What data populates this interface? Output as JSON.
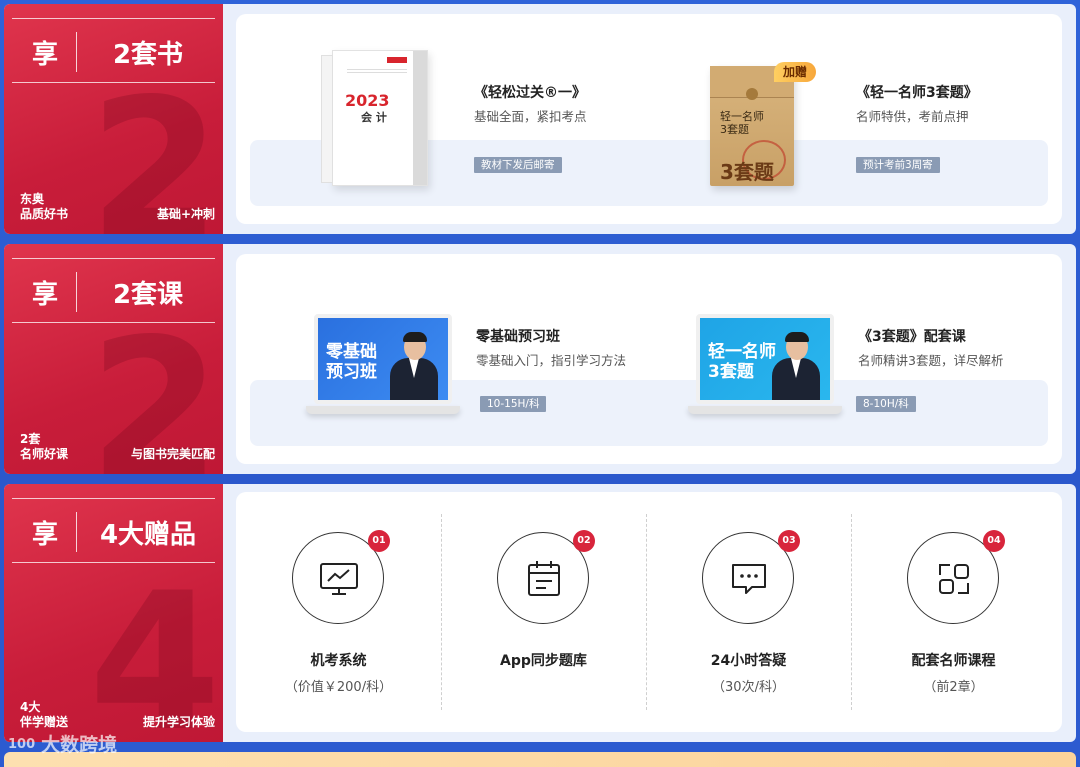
{
  "sections": [
    {
      "xiang": "享",
      "headline": "2套书",
      "bg_number": "2",
      "bottom_left": [
        "东奥",
        "品质好书"
      ],
      "bottom_right": "基础+冲刺",
      "items": [
        {
          "cover_year": "2023",
          "cover_subject": "会 计",
          "title": "《轻松过关®一》",
          "subtitle": "基础全面，紧扣考点",
          "tag": "教材下发后邮寄"
        },
        {
          "badge": "加赠",
          "cover_lines": [
            "轻一名师",
            "3套题"
          ],
          "cover_big": "3套题",
          "title": "《轻一名师3套题》",
          "subtitle": "名师特供，考前点押",
          "tag": "预计考前3周寄"
        }
      ]
    },
    {
      "xiang": "享",
      "headline": "2套课",
      "bg_number": "2",
      "bottom_left": [
        "2套",
        "名师好课"
      ],
      "bottom_right": "与图书完美匹配",
      "items": [
        {
          "screen_text": [
            "零基础",
            "预习班"
          ],
          "title": "零基础预习班",
          "subtitle": "零基础入门，指引学习方法",
          "tag": "10-15H/科"
        },
        {
          "screen_text": [
            "轻一名师",
            "3套题"
          ],
          "title": "《3套题》配套课",
          "subtitle": "名师精讲3套题，详尽解析",
          "tag": "8-10H/科"
        }
      ]
    },
    {
      "xiang": "享",
      "headline": "4大赠品",
      "bg_number": "4",
      "bottom_left": [
        "4大",
        "伴学赠送"
      ],
      "bottom_right": "提升学习体验",
      "gifts": [
        {
          "num": "01",
          "icon": "monitor-chart-icon",
          "title": "机考系统",
          "sub": "（价值￥200/科）"
        },
        {
          "num": "02",
          "icon": "calendar-icon",
          "title": "App同步题库",
          "sub": ""
        },
        {
          "num": "03",
          "icon": "chat-bubble-icon",
          "title": "24小时答疑",
          "sub": "（30次/科）"
        },
        {
          "num": "04",
          "icon": "apps-grid-icon",
          "title": "配套名师课程",
          "sub": "（前2章）"
        }
      ]
    }
  ],
  "watermark": {
    "logo": "100",
    "text": "大数跨境"
  },
  "colors": {
    "accent_red": "#c81d3a",
    "tag_gray": "#8a9bb4",
    "page_blue": "#2f63d9"
  }
}
